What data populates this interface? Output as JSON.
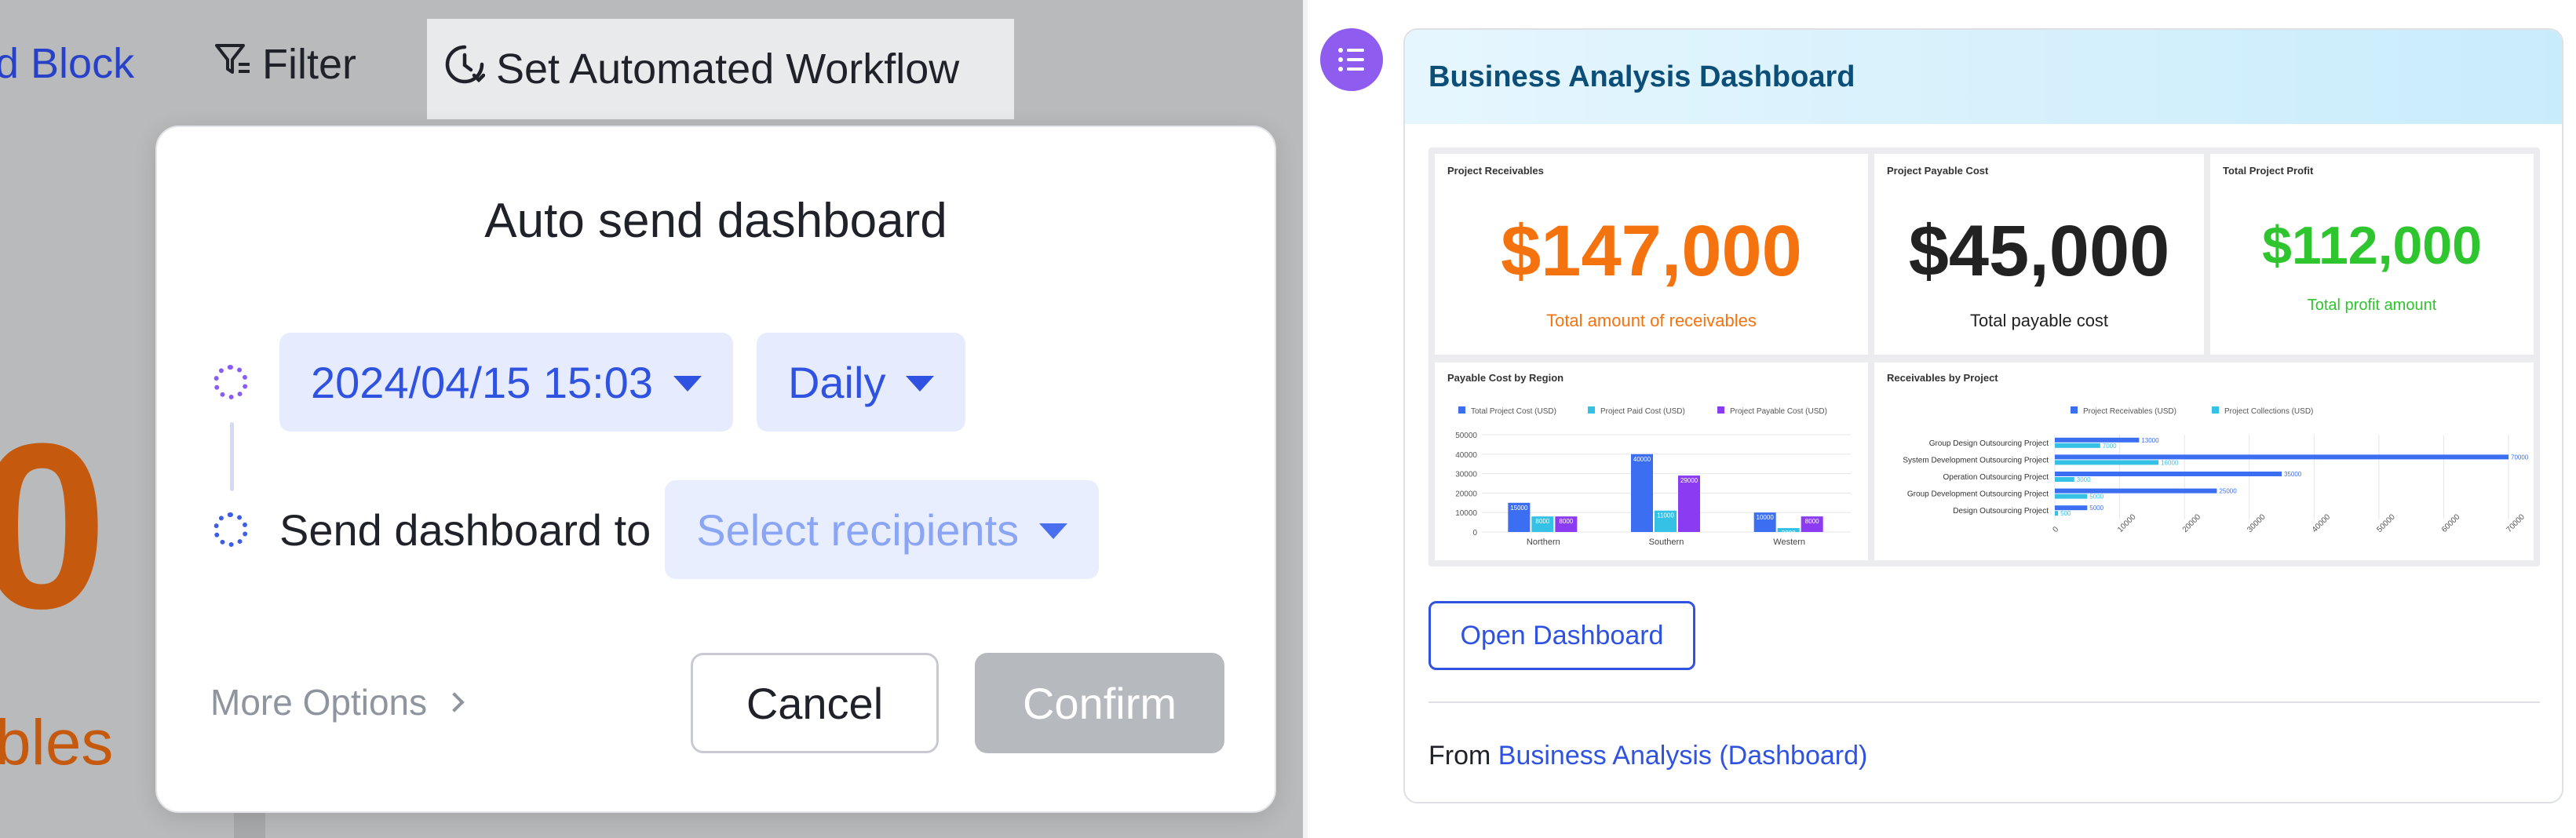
{
  "toolbar": {
    "add_block": "d Block",
    "filter": "Filter",
    "set_workflow": "Set Automated Workflow"
  },
  "background": {
    "big_value": "0",
    "small_label": "bles",
    "accent_color": "#c55a0f"
  },
  "dialog": {
    "title": "Auto send dashboard",
    "datetime": "2024/04/15 15:03",
    "frequency": "Daily",
    "send_label": "Send dashboard to",
    "recipients_placeholder": "Select recipients",
    "more_options": "More Options",
    "cancel": "Cancel",
    "confirm": "Confirm"
  },
  "message": {
    "card_title": "Business Analysis Dashboard",
    "open_button": "Open Dashboard",
    "from_prefix": "From",
    "from_link": "Business Analysis (Dashboard)"
  },
  "dashboard": {
    "kpis": [
      {
        "title": "Project Receivables",
        "value": "$147,000",
        "subtitle": "Total amount of receivables",
        "color": "#f5730f"
      },
      {
        "title": "Project Payable Cost",
        "value": "$45,000",
        "subtitle": "Total payable cost",
        "color": "#222222"
      },
      {
        "title": "Total Project Profit",
        "value": "$112,000",
        "subtitle": "Total profit amount",
        "color": "#2ec52e"
      }
    ]
  },
  "chart_data": [
    {
      "type": "bar",
      "title": "Payable Cost by Region",
      "categories": [
        "Northern",
        "Southern",
        "Western"
      ],
      "series": [
        {
          "name": "Total Project Cost (USD)",
          "values": [
            15000,
            40000,
            10000
          ],
          "color": "#3b6ef0"
        },
        {
          "name": "Project Paid Cost (USD)",
          "values": [
            8000,
            11000,
            2000
          ],
          "color": "#35c0e6"
        },
        {
          "name": "Project Payable Cost (USD)",
          "values": [
            8000,
            29000,
            8000
          ],
          "color": "#8b3cf2"
        }
      ],
      "yticks": [
        "0",
        "10000",
        "20000",
        "30000",
        "40000",
        "50000"
      ],
      "ylim": [
        0,
        50000
      ],
      "data_labels": [
        [
          "15000",
          "8000",
          "8000"
        ],
        [
          "40000",
          "11000",
          "29000"
        ],
        [
          "10000",
          "2000",
          "8000"
        ]
      ],
      "legend": "top"
    },
    {
      "type": "bar",
      "orientation": "horizontal",
      "title": "Receivables by Project",
      "categories": [
        "Group Design Outsourcing Project",
        "System Development Outsourcing Project",
        "Operation Outsourcing Project",
        "Group Development Outsourcing Project",
        "Design Outsourcing Project"
      ],
      "series": [
        {
          "name": "Project Receivables (USD)",
          "values": [
            13000,
            70000,
            35000,
            25000,
            5000
          ],
          "color": "#3b6ef0"
        },
        {
          "name": "Project Collections (USD)",
          "values": [
            7000,
            16000,
            3000,
            5000,
            500
          ],
          "color": "#35c0e6"
        }
      ],
      "xticks": [
        "0",
        "10000",
        "20000",
        "30000",
        "40000",
        "50000",
        "60000",
        "70000"
      ],
      "xlim": [
        0,
        70000
      ],
      "data_labels": [
        [
          "13000",
          "7000"
        ],
        [
          "70000",
          "16000"
        ],
        [
          "35000",
          "3000"
        ],
        [
          "25000",
          "5000"
        ],
        [
          "5000",
          "500"
        ]
      ],
      "legend": "top"
    }
  ]
}
